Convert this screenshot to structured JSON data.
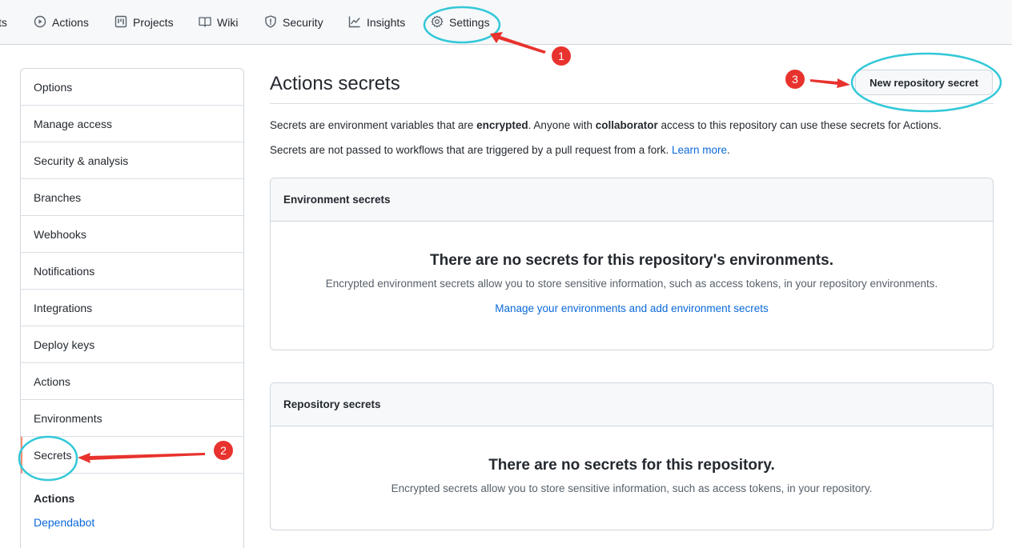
{
  "nav": {
    "partial": "ts",
    "items": [
      {
        "label": "Actions",
        "icon": "play-icon"
      },
      {
        "label": "Projects",
        "icon": "project-icon"
      },
      {
        "label": "Wiki",
        "icon": "book-icon"
      },
      {
        "label": "Security",
        "icon": "shield-icon"
      },
      {
        "label": "Insights",
        "icon": "graph-icon"
      },
      {
        "label": "Settings",
        "icon": "gear-icon"
      }
    ]
  },
  "sidebar": {
    "items": [
      {
        "label": "Options"
      },
      {
        "label": "Manage access"
      },
      {
        "label": "Security & analysis"
      },
      {
        "label": "Branches"
      },
      {
        "label": "Webhooks"
      },
      {
        "label": "Notifications"
      },
      {
        "label": "Integrations"
      },
      {
        "label": "Deploy keys"
      },
      {
        "label": "Actions"
      },
      {
        "label": "Environments"
      },
      {
        "label": "Secrets"
      }
    ],
    "selected": "Secrets",
    "group_heading": "Actions",
    "group_link": "Dependabot"
  },
  "main": {
    "title": "Actions secrets",
    "new_button": "New repository secret",
    "desc1": {
      "p1": "Secrets are environment variables that are ",
      "b1": "encrypted",
      "p2": ". Anyone with ",
      "b2": "collaborator",
      "p3": " access to this repository can use these secrets for Actions."
    },
    "desc2": {
      "p1": "Secrets are not passed to workflows that are triggered by a pull request from a fork. ",
      "link": "Learn more",
      "p2": "."
    },
    "env_box": {
      "heading": "Environment secrets",
      "blank_title": "There are no secrets for this repository's environments.",
      "blank_text": "Encrypted environment secrets allow you to store sensitive information, such as access tokens, in your repository environments.",
      "link": "Manage your environments and add environment secrets"
    },
    "repo_box": {
      "heading": "Repository secrets",
      "blank_title": "There are no secrets for this repository.",
      "blank_text": "Encrypted secrets allow you to store sensitive information, such as access tokens, in your repository."
    }
  },
  "annotations": {
    "badge1": "1",
    "badge2": "2",
    "badge3": "3",
    "circle_color": "#33c8d8",
    "arrow_color": "#e8322d"
  },
  "colors": {
    "link": "#0969da",
    "selected_marker": "#fd8c73",
    "nav_bg": "#f6f8fa"
  }
}
